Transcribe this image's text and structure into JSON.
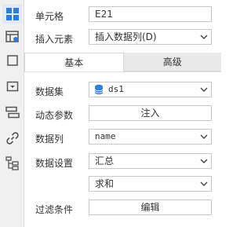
{
  "sidebar": {
    "icons": [
      {
        "name": "cell-element-icon",
        "active": true
      },
      {
        "name": "cell-attribute-icon",
        "active": false
      },
      {
        "name": "cell-style-icon",
        "active": false
      },
      {
        "name": "widget-settings-icon",
        "active": false
      },
      {
        "name": "condition-attribute-icon",
        "active": false
      },
      {
        "name": "hyperlink-icon",
        "active": false
      },
      {
        "name": "tree-structure-icon",
        "active": false
      }
    ]
  },
  "cell": {
    "label": "单元格",
    "value": "E21"
  },
  "insert": {
    "label": "插入元素",
    "value": "插入数据列(D)"
  },
  "tabs": {
    "basic": "基本",
    "advanced": "高级"
  },
  "dataset": {
    "label": "数据集",
    "value": "ds1",
    "icon": "database-icon"
  },
  "dynamic_param": {
    "label": "动态参数",
    "button": "注入"
  },
  "data_column": {
    "label": "数据列",
    "value": "name"
  },
  "data_setting": {
    "label": "数据设置",
    "value": "汇总",
    "aggregate": "求和"
  },
  "filter": {
    "label": "过滤条件",
    "button": "编辑"
  },
  "colors": {
    "accent": "#2f7dd3",
    "active_tab_bg": "#ffffff",
    "inactive_tab_bg": "#e9e9e9"
  }
}
